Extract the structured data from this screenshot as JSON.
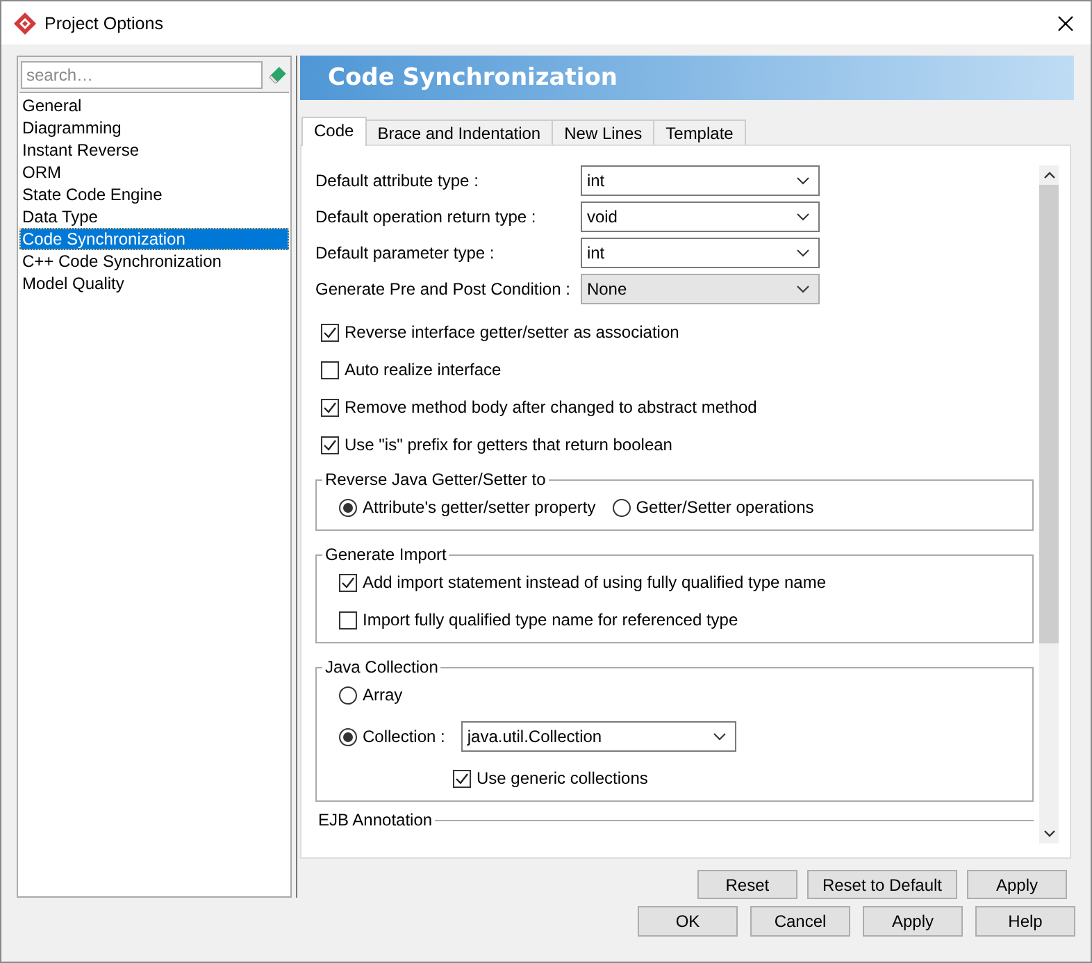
{
  "window": {
    "title": "Project Options"
  },
  "sidebar": {
    "search": {
      "placeholder": "search…"
    },
    "items": [
      {
        "label": "General",
        "selected": false
      },
      {
        "label": "Diagramming",
        "selected": false
      },
      {
        "label": "Instant Reverse",
        "selected": false
      },
      {
        "label": "ORM",
        "selected": false
      },
      {
        "label": "State Code Engine",
        "selected": false
      },
      {
        "label": "Data Type",
        "selected": false
      },
      {
        "label": "Code Synchronization",
        "selected": true
      },
      {
        "label": "C++ Code Synchronization",
        "selected": false
      },
      {
        "label": "Model Quality",
        "selected": false
      }
    ]
  },
  "panel": {
    "title": "Code Synchronization",
    "tabs": [
      {
        "label": "Code",
        "selected": true
      },
      {
        "label": "Brace and Indentation",
        "selected": false
      },
      {
        "label": "New Lines",
        "selected": false
      },
      {
        "label": "Template",
        "selected": false
      }
    ],
    "fields": [
      {
        "label": "Default attribute type :",
        "value": "int",
        "editable": true
      },
      {
        "label": "Default operation return type :",
        "value": "void",
        "editable": true
      },
      {
        "label": "Default parameter type :",
        "value": "int",
        "editable": true
      },
      {
        "label": "Generate Pre and Post Condition :",
        "value": "None",
        "editable": false
      }
    ],
    "options": [
      {
        "label": "Reverse interface getter/setter as association",
        "checked": true
      },
      {
        "label": "Auto realize interface",
        "checked": false
      },
      {
        "label": "Remove method body after changed to abstract method",
        "checked": true
      },
      {
        "label": "Use \"is\" prefix for getters that return boolean",
        "checked": true
      }
    ],
    "groups": [
      {
        "title": "Reverse Java Getter/Setter to",
        "kind": "inline",
        "items": [
          {
            "kind": "radio",
            "label": "Attribute's getter/setter property",
            "selected": true
          },
          {
            "kind": "radio",
            "label": "Getter/Setter operations",
            "selected": false
          }
        ]
      },
      {
        "title": "Generate Import",
        "kind": "stacked",
        "items": [
          {
            "kind": "checkbox",
            "label": "Add import statement instead of using fully qualified type name",
            "checked": true
          },
          {
            "kind": "checkbox",
            "label": "Import fully qualified type name for referenced type",
            "checked": false
          }
        ]
      },
      {
        "title": "Java Collection",
        "kind": "stacked",
        "items": [
          {
            "kind": "radio",
            "label": "Array",
            "selected": false
          },
          {
            "kind": "radio",
            "label": "Collection :",
            "selected": true,
            "combo": {
              "value": "java.util.Collection"
            }
          },
          {
            "kind": "subcheckbox",
            "label": "Use generic collections",
            "checked": true
          }
        ]
      },
      {
        "title": "EJB Annotation"
      }
    ],
    "buttons": [
      "Reset",
      "Reset to Default",
      "Apply"
    ]
  },
  "dialog_buttons": [
    "OK",
    "Cancel",
    "Apply",
    "Help"
  ]
}
